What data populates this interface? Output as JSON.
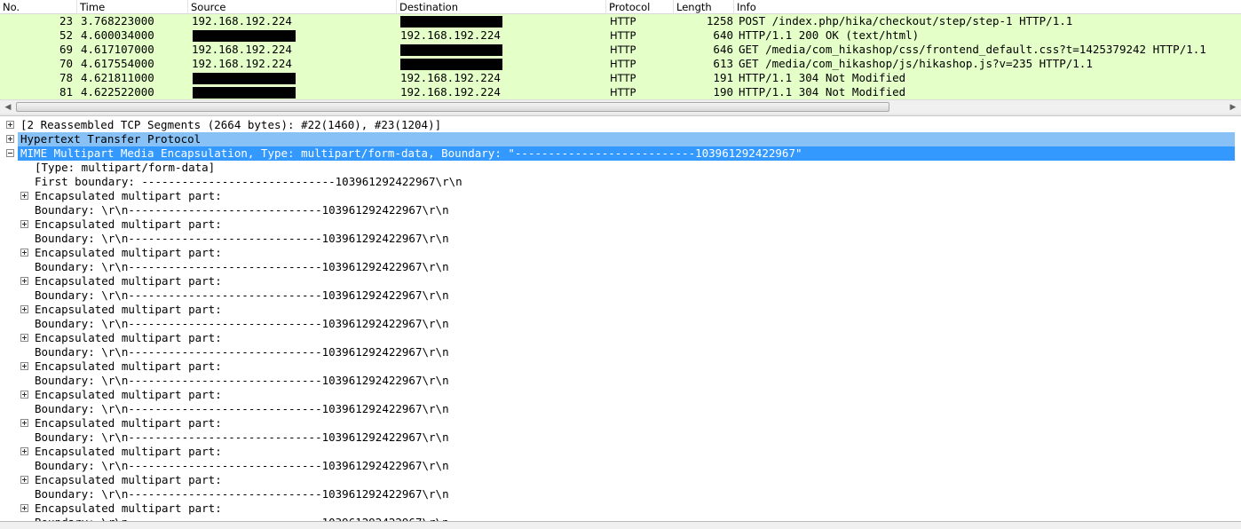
{
  "columns": {
    "no": "No.",
    "time": "Time",
    "source": "Source",
    "destination": "Destination",
    "protocol": "Protocol",
    "length": "Length",
    "info": "Info"
  },
  "packets": [
    {
      "no": "23",
      "time": "3.768223000",
      "source": "192.168.192.224",
      "destination": "",
      "protocol": "HTTP",
      "length": "1258",
      "info": "POST /index.php/hika/checkout/step/step-1 HTTP/1.1",
      "redacted": "destination"
    },
    {
      "no": "52",
      "time": "4.600034000",
      "source": "",
      "destination": "192.168.192.224",
      "protocol": "HTTP",
      "length": "640",
      "info": "HTTP/1.1 200 OK  (text/html)",
      "redacted": "source"
    },
    {
      "no": "69",
      "time": "4.617107000",
      "source": "192.168.192.224",
      "destination": "",
      "protocol": "HTTP",
      "length": "646",
      "info": "GET /media/com_hikashop/css/frontend_default.css?t=1425379242 HTTP/1.1",
      "redacted": "destination"
    },
    {
      "no": "70",
      "time": "4.617554000",
      "source": "192.168.192.224",
      "destination": "",
      "protocol": "HTTP",
      "length": "613",
      "info": "GET /media/com_hikashop/js/hikashop.js?v=235 HTTP/1.1",
      "redacted": "destination"
    },
    {
      "no": "78",
      "time": "4.621811000",
      "source": "",
      "destination": "192.168.192.224",
      "protocol": "HTTP",
      "length": "191",
      "info": "HTTP/1.1 304 Not Modified",
      "redacted": "source"
    },
    {
      "no": "81",
      "time": "4.622522000",
      "source": "",
      "destination": "192.168.192.224",
      "protocol": "HTTP",
      "length": "190",
      "info": "HTTP/1.1 304 Not Modified",
      "redacted": "source"
    }
  ],
  "colors": {
    "http_row": "#e4ffc7",
    "selection_light": "#87c1f5",
    "selection_dark": "#3399ff"
  },
  "details": {
    "reassembled": "[2 Reassembled TCP Segments (2664 bytes): #22(1460), #23(1204)]",
    "http": "Hypertext Transfer Protocol",
    "mime": "MIME Multipart Media Encapsulation, Type: multipart/form-data, Boundary: \"---------------------------103961292422967\"",
    "type": "[Type: multipart/form-data]",
    "first_boundary": "First boundary: -----------------------------103961292422967\\r\\n",
    "part_label": "Encapsulated multipart part:",
    "boundary": "Boundary: \\r\\n-----------------------------103961292422967\\r\\n"
  }
}
